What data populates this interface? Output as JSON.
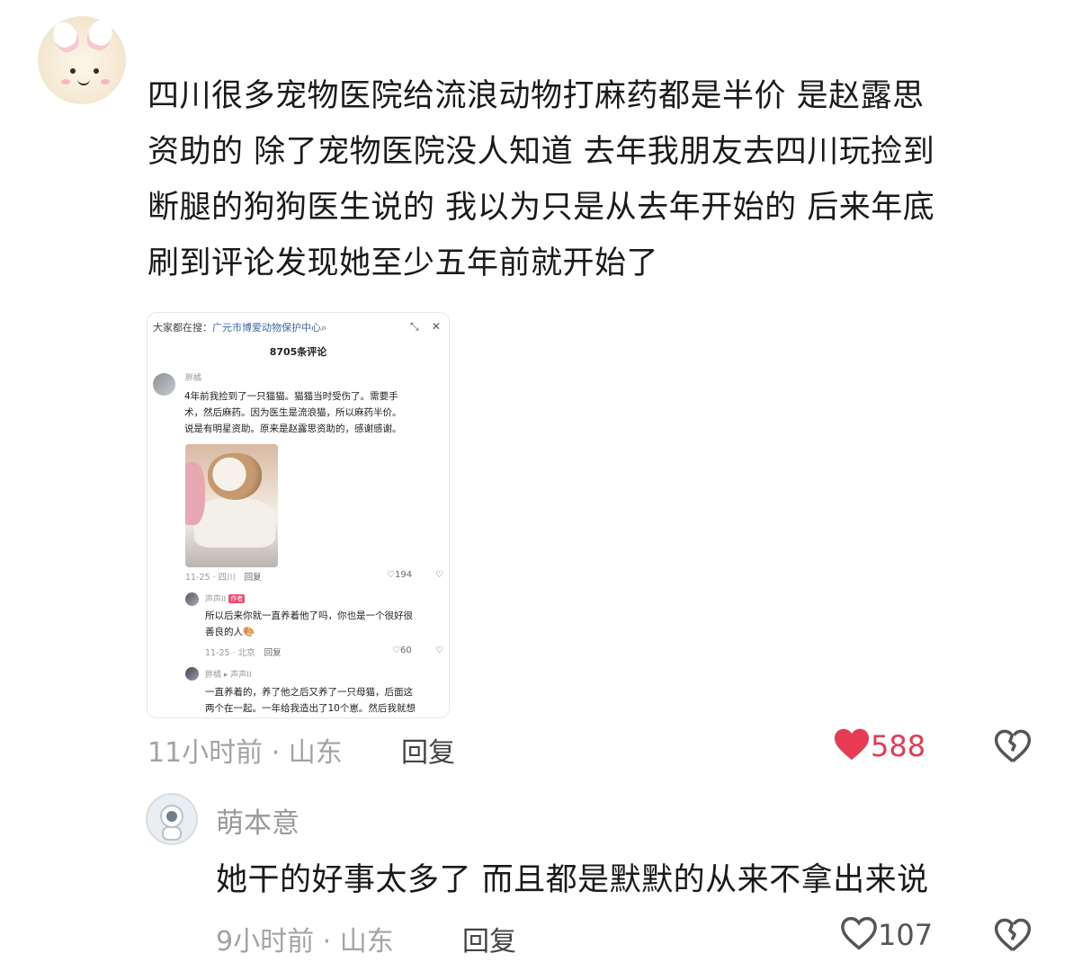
{
  "main_comment": {
    "avatar_icon": "bunny-avatar-icon",
    "text_lines": [
      "四川很多宠物医院给流浪动物打麻药都是半价 是赵露思",
      "资助的 除了宠物医院没人知道 去年我朋友去四川玩捡到",
      "断腿的狗狗医生说的 我以为只是从去年开始的 后来年底",
      "刷到评论发现她至少五年前就开始了"
    ],
    "time_location": "11小时前 · 山东",
    "reply_label": "回复",
    "like_count": "588",
    "liked": true,
    "like_color": "#e63b52"
  },
  "embedded_screenshot": {
    "search_prefix": "大家都在搜：",
    "search_term": "广元市博爱动物保护中心",
    "comment_count": "8705条评论",
    "c1_name": "胖橘",
    "c1_lines": [
      "4年前我捡到了一只猫猫。猫猫当时受伤了。需要手",
      "术，然后麻药。因为医生是流浪猫，所以麻药半价。",
      "说是有明星资助。原来是赵露思资助的，感谢感谢。"
    ],
    "c1_meta": "11-25 · 四川",
    "c1_reply": "回复",
    "c1_likes": "194",
    "c2_name": "声声II",
    "c2_tag": "作者",
    "c2_lines": [
      "所以后来你就一直养着他了吗，你也是一个很好很",
      "善良的人🎨"
    ],
    "c2_meta": "11-25 · 北京",
    "c2_reply": "回复",
    "c2_likes": "60",
    "c3_name": "胖橘 ▸ 声声II",
    "c3_lines": [
      "一直养着的，养了他之后又养了一只母猫，后面这",
      "两个在一起。一年给我造出了10个崽。然后我就想"
    ]
  },
  "reply_comment": {
    "username": "萌本意",
    "text": "她干的好事太多了 而且都是默默的从来不拿出来说",
    "time_location": "9小时前 · 山东",
    "reply_label": "回复",
    "like_count": "107",
    "liked": false
  }
}
